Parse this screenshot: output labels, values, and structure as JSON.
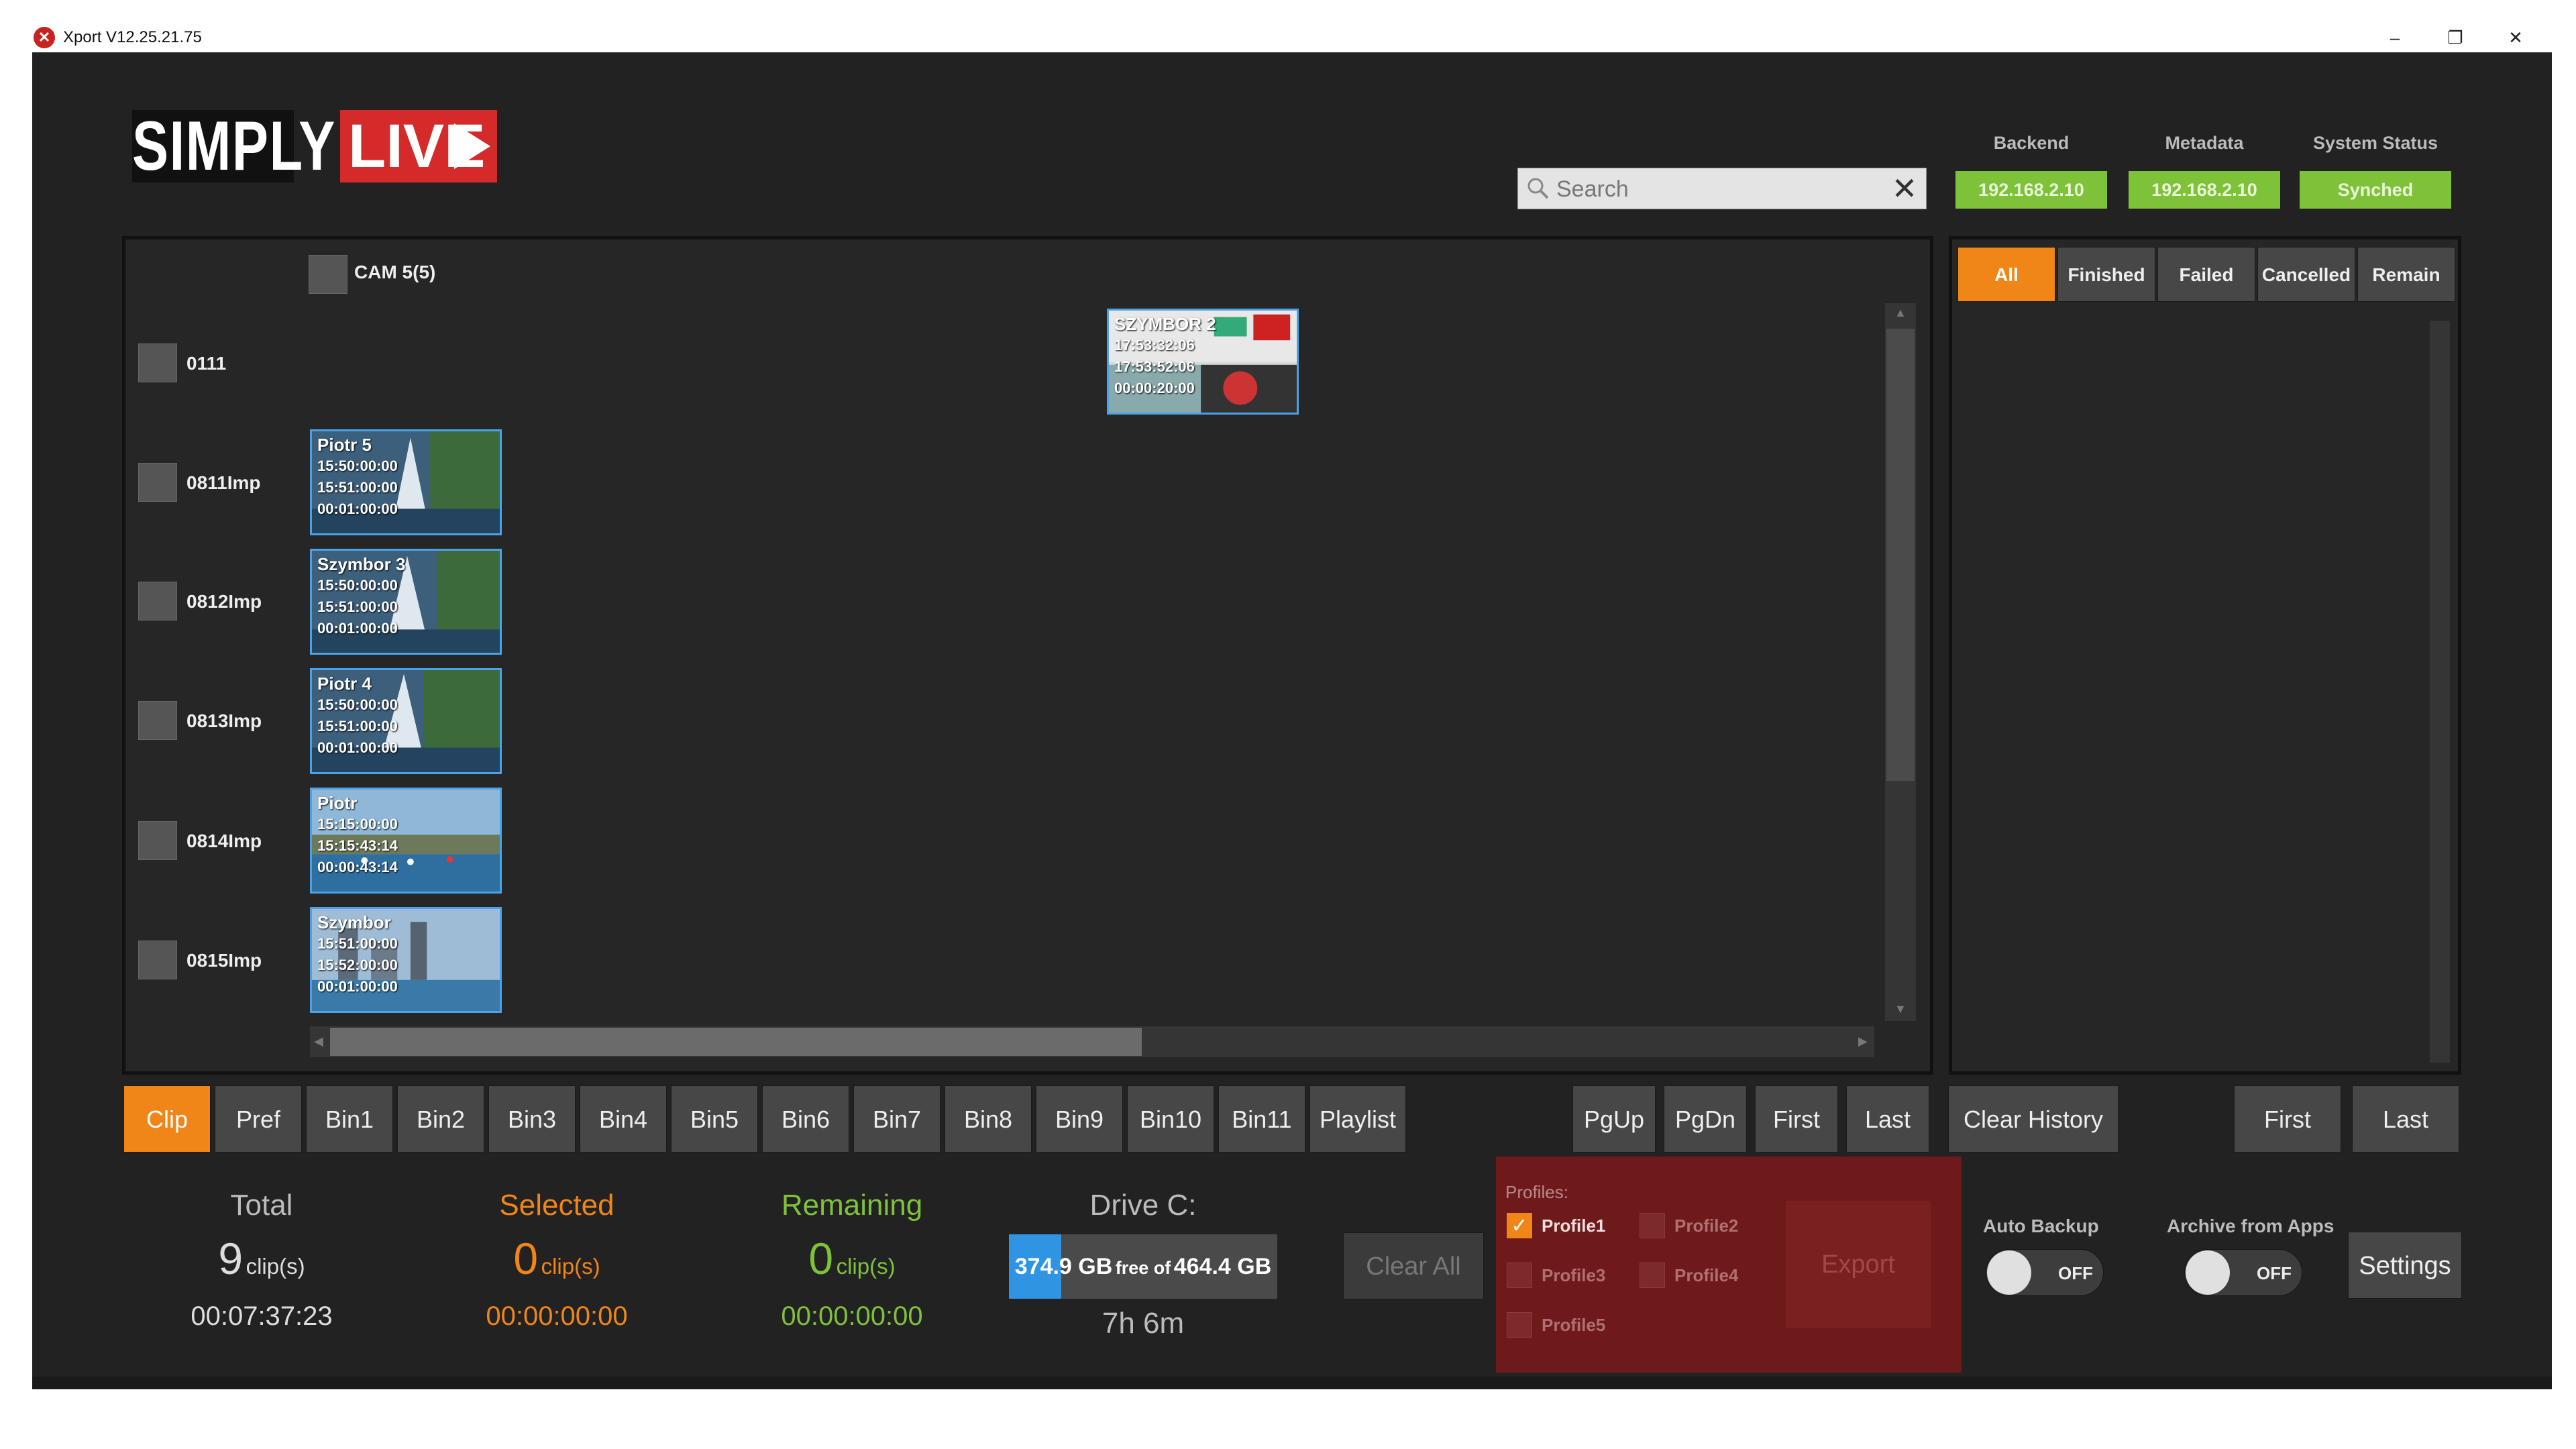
{
  "window": {
    "title": "Xport V12.25.21.75",
    "icon": "xport-app-icon",
    "minimize": "–",
    "restore": "❐",
    "close": "✕"
  },
  "logo": {
    "part1": "SIMPLY",
    "part2": "LIVE"
  },
  "search": {
    "placeholder": "Search",
    "value": "",
    "clear_icon": "✕"
  },
  "status": {
    "backend_label": "Backend",
    "backend_value": "192.168.2.10",
    "metadata_label": "Metadata",
    "metadata_value": "192.168.2.10",
    "system_label": "System Status",
    "system_value": "Synched",
    "ok_color": "#7ec23a"
  },
  "clips": {
    "camera_label": "CAM 5(5)",
    "rows": [
      {
        "label": "0111",
        "clip": {
          "title": "SZYMBOR 2",
          "in": "17:53:32:06",
          "out": "17:53:52:06",
          "dur": "00:00:20:00"
        }
      },
      {
        "label": "0811Imp",
        "clip": {
          "title": "Piotr 5",
          "in": "15:50:00:00",
          "out": "15:51:00:00",
          "dur": "00:01:00:00"
        }
      },
      {
        "label": "0812Imp",
        "clip": {
          "title": "Szymbor 3",
          "in": "15:50:00:00",
          "out": "15:51:00:00",
          "dur": "00:01:00:00"
        }
      },
      {
        "label": "0813Imp",
        "clip": {
          "title": "Piotr 4",
          "in": "15:50:00:00",
          "out": "15:51:00:00",
          "dur": "00:01:00:00"
        }
      },
      {
        "label": "0814Imp",
        "clip": {
          "title": "Piotr",
          "in": "15:15:00:00",
          "out": "15:15:43:14",
          "dur": "00:00:43:14"
        }
      },
      {
        "label": "0815Imp",
        "clip": {
          "title": "Szymbor",
          "in": "15:51:00:00",
          "out": "15:52:00:00",
          "dur": "00:01:00:00"
        }
      }
    ]
  },
  "history": {
    "filters": [
      "All",
      "Finished",
      "Failed",
      "Cancelled",
      "Remain"
    ],
    "active_filter": "All"
  },
  "bins": [
    "Clip",
    "Pref",
    "Bin1",
    "Bin2",
    "Bin3",
    "Bin4",
    "Bin5",
    "Bin6",
    "Bin7",
    "Bin8",
    "Bin9",
    "Bin10",
    "Bin11",
    "Playlist"
  ],
  "active_bin": "Clip",
  "pager": {
    "pgup": "PgUp",
    "pgdn": "PgDn",
    "first": "First",
    "last": "Last"
  },
  "history_buttons": {
    "clear": "Clear History",
    "first": "First",
    "last": "Last"
  },
  "stats": {
    "total_label": "Total",
    "total_count": "9",
    "total_unit": "clip(s)",
    "total_time": "00:07:37:23",
    "selected_label": "Selected",
    "selected_count": "0",
    "selected_unit": "clip(s)",
    "selected_time": "00:00:00:00",
    "remaining_label": "Remaining",
    "remaining_count": "0",
    "remaining_unit": "clip(s)",
    "remaining_time": "00:00:00:00",
    "selected_color": "#f08518",
    "remaining_color": "#7ec23a"
  },
  "drive": {
    "title": "Drive C:",
    "free": "374.9 GB",
    "free_of": "free of",
    "total": "464.4 GB",
    "time_left": "7h 6m",
    "used_fraction": 0.195
  },
  "clear_all": "Clear All",
  "profiles": {
    "label": "Profiles:",
    "items": [
      {
        "name": "Profile1",
        "checked": true
      },
      {
        "name": "Profile2",
        "checked": false
      },
      {
        "name": "Profile3",
        "checked": false
      },
      {
        "name": "Profile4",
        "checked": false
      },
      {
        "name": "Profile5",
        "checked": false
      }
    ],
    "export": "Export"
  },
  "toggles": {
    "auto_backup_label": "Auto Backup",
    "auto_backup_state": "OFF",
    "archive_label": "Archive from Apps",
    "archive_state": "OFF"
  },
  "settings": "Settings"
}
